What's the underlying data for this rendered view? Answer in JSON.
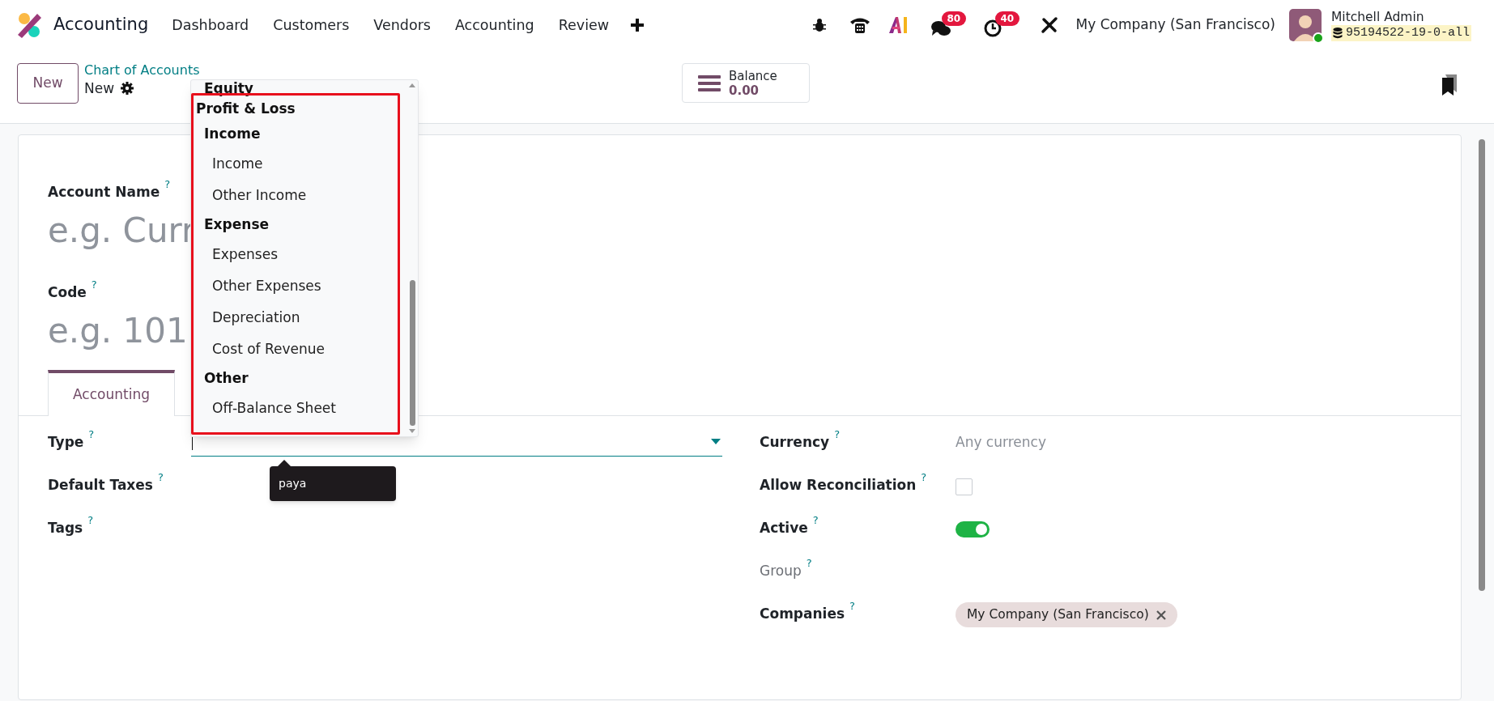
{
  "app": {
    "name": "Accounting"
  },
  "menu": [
    {
      "label": "Dashboard"
    },
    {
      "label": "Customers"
    },
    {
      "label": "Vendors"
    },
    {
      "label": "Accounting"
    },
    {
      "label": "Review"
    }
  ],
  "systray": {
    "messages_badge": "80",
    "activities_badge": "40",
    "company": "My Company (San Francisco)",
    "user": "Mitchell Admin",
    "database": "95194522-19-0-all"
  },
  "control_panel": {
    "new_button": "New",
    "breadcrumb": "Chart of Accounts",
    "record": "New",
    "balance_label": "Balance",
    "balance_value": "0.00"
  },
  "form": {
    "account_name": {
      "label": "Account Name",
      "help": "?",
      "placeholder": "e.g. Curr"
    },
    "code": {
      "label": "Code",
      "help": "?",
      "placeholder": "e.g. 101"
    },
    "tabs": [
      {
        "label": "Accounting",
        "selected": true
      }
    ],
    "left_fields": [
      {
        "label": "Type",
        "help": "?",
        "kind": "select"
      },
      {
        "label": "Default Taxes",
        "help": "?",
        "kind": "empty"
      },
      {
        "label": "Tags",
        "help": "?",
        "kind": "empty"
      }
    ],
    "right_fields": [
      {
        "label": "Currency",
        "help": "?",
        "kind": "text",
        "value": "Any currency",
        "disabled": false
      },
      {
        "label": "Allow Reconciliation",
        "help": "?",
        "kind": "checkbox",
        "checked": false,
        "disabled": false
      },
      {
        "label": "Active",
        "help": "?",
        "kind": "toggle",
        "on": true,
        "disabled": false
      },
      {
        "label": "Group",
        "help": "?",
        "kind": "empty",
        "disabled": true
      },
      {
        "label": "Companies",
        "help": "?",
        "kind": "tags",
        "tags": [
          "My Company (San Francisco)"
        ],
        "disabled": false
      }
    ],
    "tooltip": "paya"
  },
  "dropdown": {
    "items": [
      {
        "label": "Equity",
        "kind": "subheader"
      },
      {
        "label": "Profit & Loss",
        "kind": "header",
        "children": [
          {
            "label": "Income",
            "kind": "subheader",
            "children": [
              {
                "label": "Income",
                "kind": "option"
              },
              {
                "label": "Other Income",
                "kind": "option"
              }
            ]
          },
          {
            "label": "Expense",
            "kind": "subheader",
            "children": [
              {
                "label": "Expenses",
                "kind": "option"
              },
              {
                "label": "Other Expenses",
                "kind": "option"
              },
              {
                "label": "Depreciation",
                "kind": "option"
              },
              {
                "label": "Cost of Revenue",
                "kind": "option"
              }
            ]
          },
          {
            "label": "Other",
            "kind": "subheader",
            "children": [
              {
                "label": "Off-Balance Sheet",
                "kind": "option"
              }
            ]
          }
        ]
      }
    ]
  }
}
